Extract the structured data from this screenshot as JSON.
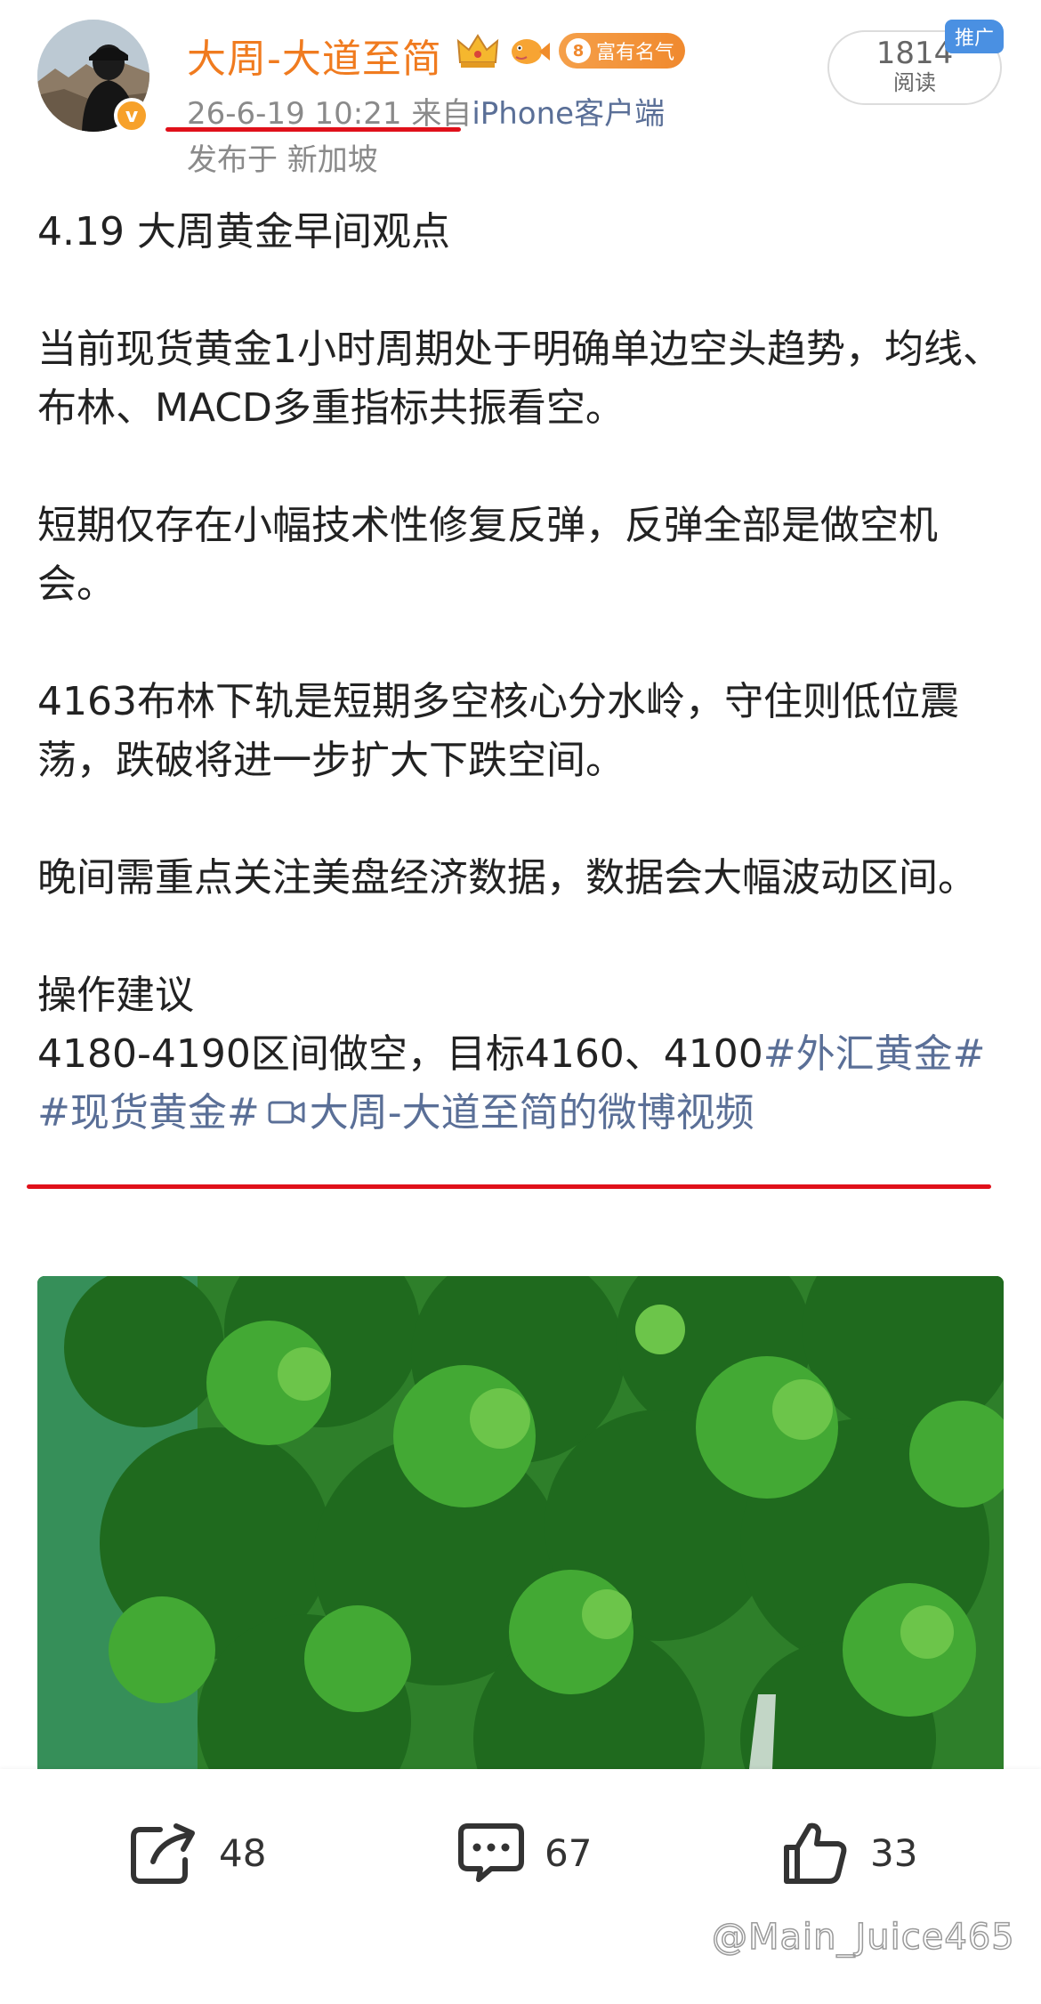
{
  "post": {
    "author": "大周-大道至简",
    "fame_badge": "富有名气",
    "fame_level": "8",
    "verified_mark": "v",
    "timestamp": "26-6-19 10:21",
    "via_prefix": "来自",
    "source": "iPhone客户端",
    "location": "发布于 新加坡",
    "reads": "1814",
    "reads_label": "阅读",
    "promo_tag": "推广",
    "title": "4.19 大周黄金早间观点",
    "para1": "当前现货黄金1小时周期处于明确单边空头趋势，均线、布林、MACD多重指标共振看空。",
    "para2": "短期仅存在小幅技术性修复反弹，反弹全部是做空机会。",
    "para3": "4163布林下轨是短期多空核心分水岭，守住则低位震荡，跌破将进一步扩大下跌空间。",
    "para4": "晚间需重点关注美盘经济数据，数据会大幅波动区间。",
    "advice_heading": "操作建议",
    "advice": "4180-4190区间做空，目标4160、4100",
    "tag1": "#外汇黄金#",
    "tag2": "#现货黄金#",
    "video_link": "大周-大道至简的微博视频"
  },
  "actions": {
    "share_count": "48",
    "comment_count": "67",
    "like_count": "33"
  },
  "watermark": "@Main_Juice465",
  "icons": {
    "crown": "crown-icon",
    "fish": "fish-icon",
    "share": "share-icon",
    "comment": "comment-icon",
    "like": "thumbs-up-icon",
    "video": "video-icon"
  },
  "colors": {
    "author": "#f07b1f",
    "link": "#5a6f97",
    "underline": "#e0101a",
    "promo": "#4a90e2"
  }
}
